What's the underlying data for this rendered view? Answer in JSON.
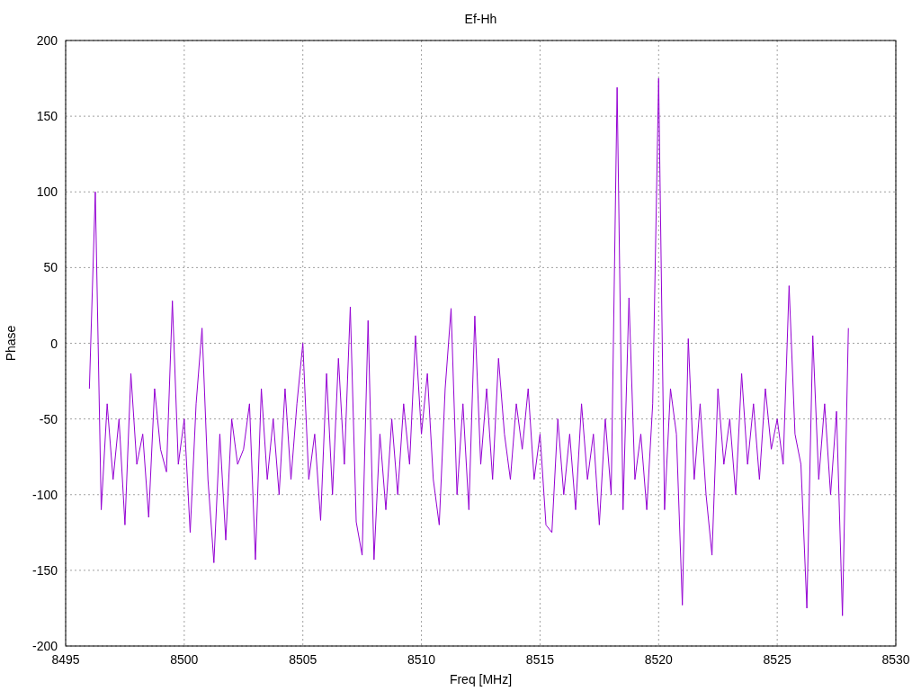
{
  "chart": {
    "chart_data": {
      "type": "line",
      "title": "Ef-Hh",
      "xlabel": "Freq [MHz]",
      "ylabel": "Phase",
      "xlim": [
        8495,
        8530
      ],
      "ylim": [
        -200,
        200
      ],
      "xticks": [
        8495,
        8500,
        8505,
        8510,
        8515,
        8520,
        8525,
        8530
      ],
      "yticks": [
        -200,
        -150,
        -100,
        -50,
        0,
        50,
        100,
        150,
        200
      ],
      "x": [
        8496,
        8496.25,
        8496.5,
        8496.75,
        8497,
        8497.25,
        8497.5,
        8497.75,
        8498,
        8498.25,
        8498.5,
        8498.75,
        8499,
        8499.25,
        8499.5,
        8499.75,
        8500,
        8500.25,
        8500.5,
        8500.75,
        8501,
        8501.25,
        8501.5,
        8501.75,
        8502,
        8502.25,
        8502.5,
        8502.75,
        8503,
        8503.25,
        8503.5,
        8503.75,
        8504,
        8504.25,
        8504.5,
        8504.75,
        8505,
        8505.25,
        8505.5,
        8505.75,
        8506,
        8506.25,
        8506.5,
        8506.75,
        8507,
        8507.25,
        8507.5,
        8507.75,
        8508,
        8508.25,
        8508.5,
        8508.75,
        8509,
        8509.25,
        8509.5,
        8509.75,
        8510,
        8510.25,
        8510.5,
        8510.75,
        8511,
        8511.25,
        8511.5,
        8511.75,
        8512,
        8512.25,
        8512.5,
        8512.75,
        8513,
        8513.25,
        8513.5,
        8513.75,
        8514,
        8514.25,
        8514.5,
        8514.75,
        8515,
        8515.25,
        8515.5,
        8515.75,
        8516,
        8516.25,
        8516.5,
        8516.75,
        8517,
        8517.25,
        8517.5,
        8517.75,
        8518,
        8518.25,
        8518.5,
        8518.75,
        8519,
        8519.25,
        8519.5,
        8519.75,
        8520,
        8520.25,
        8520.5,
        8520.75,
        8521,
        8521.25,
        8521.5,
        8521.75,
        8522,
        8522.25,
        8522.5,
        8522.75,
        8523,
        8523.25,
        8523.5,
        8523.75,
        8524,
        8524.25,
        8524.5,
        8524.75,
        8525,
        8525.25,
        8525.5,
        8525.75,
        8526,
        8526.25,
        8526.5,
        8526.75,
        8527,
        8527.25,
        8527.5,
        8527.75,
        8528
      ],
      "grid": true,
      "series": [
        {
          "color": "#9400d3",
          "values": [
            -30,
            100,
            -110,
            -40,
            -90,
            -50,
            -120,
            -20,
            -80,
            -60,
            -115,
            -30,
            -70,
            -85,
            28,
            -80,
            -50,
            -125,
            -40,
            10,
            -90,
            -145,
            -60,
            -130,
            -50,
            -80,
            -70,
            -40,
            -143,
            -30,
            -90,
            -50,
            -100,
            -30,
            -90,
            -40,
            0,
            -90,
            -60,
            -117,
            -20,
            -100,
            -10,
            -80,
            24,
            -118,
            -140,
            15,
            -143,
            -60,
            -110,
            -50,
            -100,
            -40,
            -80,
            5,
            -60,
            -20,
            -90,
            -120,
            -30,
            23,
            -100,
            -40,
            -110,
            18,
            -80,
            -30,
            -90,
            -10,
            -60,
            -90,
            -40,
            -70,
            -30,
            -90,
            -60,
            -120,
            -125,
            -50,
            -100,
            -60,
            -110,
            -40,
            -90,
            -60,
            -120,
            -50,
            -100,
            169,
            -110,
            30,
            -90,
            -60,
            -110,
            -40,
            175,
            -110,
            -30,
            -60,
            -173,
            3,
            -90,
            -40,
            -100,
            -140,
            -30,
            -80,
            -50,
            -100,
            -20,
            -80,
            -40,
            -90,
            -30,
            -70,
            -50,
            -80,
            38,
            -60,
            -80,
            -175,
            5,
            -90,
            -40,
            -100,
            -45,
            -180,
            10
          ]
        }
      ]
    }
  }
}
